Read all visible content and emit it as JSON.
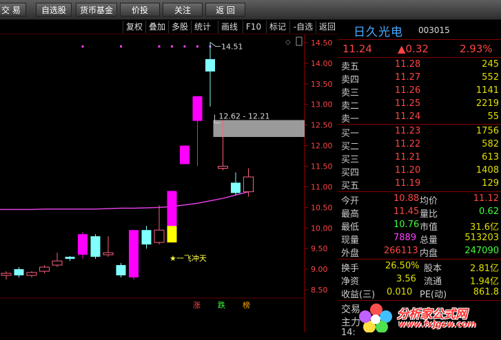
{
  "toolbar": {
    "items": [
      "交 易",
      "自选股",
      "货币基金",
      "价投",
      "关注",
      "返 回"
    ]
  },
  "subtoolbar": {
    "items": [
      "复权",
      "叠加",
      "多股",
      "统计",
      "画线",
      "F10",
      "标记",
      "-自选",
      "返回"
    ]
  },
  "stock": {
    "name": "日久光电",
    "code": "003015",
    "price": "11.24",
    "change": "▲0.32",
    "change_pct": "2.93%"
  },
  "order_book": {
    "asks": [
      {
        "label": "卖五",
        "price": "11.28",
        "qty": "245"
      },
      {
        "label": "卖四",
        "price": "11.27",
        "qty": "552"
      },
      {
        "label": "卖三",
        "price": "11.26",
        "qty": "1141"
      },
      {
        "label": "卖二",
        "price": "11.25",
        "qty": "2219"
      },
      {
        "label": "卖一",
        "price": "11.24",
        "qty": "55"
      }
    ],
    "bids": [
      {
        "label": "买一",
        "price": "11.23",
        "qty": "1756"
      },
      {
        "label": "买二",
        "price": "11.22",
        "qty": "582"
      },
      {
        "label": "买三",
        "price": "11.21",
        "qty": "613"
      },
      {
        "label": "买四",
        "price": "11.20",
        "qty": "1408"
      },
      {
        "label": "买五",
        "price": "11.19",
        "qty": "129"
      }
    ]
  },
  "quote": {
    "open_label": "今开",
    "open": "10.88",
    "avg_label": "均价",
    "avg": "11.12",
    "high_label": "最高",
    "high": "11.45",
    "ratio_label": "量比",
    "ratio": "0.62",
    "low_label": "最低",
    "low": "10.76",
    "mcap_label": "市值",
    "mcap": "31.6亿",
    "vol_label": "现量",
    "vol": "7889",
    "total_label": "总量",
    "total": "513203",
    "outer_label": "外盘",
    "outer": "266113",
    "inner_label": "内盘",
    "inner": "247090",
    "turnover_label": "换手",
    "turnover": "26.50%",
    "shares_label": "股本",
    "shares": "2.81亿",
    "nav_label": "净资",
    "nav": "3.56",
    "float_label": "流通",
    "float": "1.94亿",
    "eps_label": "收益(三)",
    "eps": "0.010",
    "pe_label": "PE(动)",
    "pe": "861.8"
  },
  "bottom": {
    "trade_label": "交易",
    "main_label": "主力",
    "time_label": "14:"
  },
  "watermark": {
    "line1": "分析家公式网",
    "line2": "www.fxjgsw.com"
  },
  "chart_data": {
    "type": "candlestick",
    "y_ticks": [
      "14.50",
      "14.00",
      "13.50",
      "13.00",
      "12.50",
      "12.00",
      "11.50",
      "11.00",
      "10.50",
      "10.00",
      "9.50",
      "9.00",
      "8.50"
    ],
    "ylim": [
      8.3,
      14.7
    ],
    "candles": [
      {
        "o": 8.85,
        "c": 8.9,
        "h": 8.95,
        "l": 8.75,
        "color": "pink"
      },
      {
        "o": 8.85,
        "c": 9.0,
        "h": 9.05,
        "l": 8.8,
        "color": "cyan"
      },
      {
        "o": 8.85,
        "c": 8.92,
        "h": 8.95,
        "l": 8.8,
        "color": "pink"
      },
      {
        "o": 8.95,
        "c": 9.05,
        "h": 9.1,
        "l": 8.9,
        "color": "pink"
      },
      {
        "o": 9.1,
        "c": 9.2,
        "h": 9.4,
        "l": 9.05,
        "color": "pink"
      },
      {
        "o": 9.25,
        "c": 9.3,
        "h": 9.32,
        "l": 9.2,
        "color": "cyan"
      },
      {
        "o": 9.35,
        "c": 9.85,
        "h": 9.9,
        "l": 9.25,
        "color": "magenta"
      },
      {
        "o": 9.3,
        "c": 9.8,
        "h": 9.85,
        "l": 9.25,
        "color": "cyan"
      },
      {
        "o": 9.35,
        "c": 9.4,
        "h": 9.8,
        "l": 9.3,
        "color": "pink"
      },
      {
        "o": 8.85,
        "c": 9.1,
        "h": 9.15,
        "l": 8.8,
        "color": "cyan"
      },
      {
        "o": 8.8,
        "c": 9.95,
        "h": 9.95,
        "l": 8.75,
        "color": "magenta"
      },
      {
        "o": 9.6,
        "c": 9.95,
        "h": 10.05,
        "l": 9.5,
        "color": "cyan"
      },
      {
        "o": 9.65,
        "c": 9.95,
        "h": 10.55,
        "l": 9.6,
        "color": "pink"
      },
      {
        "o": 9.65,
        "c": 10.9,
        "h": 10.9,
        "l": 9.65,
        "color": "magenta"
      },
      {
        "o": 11.55,
        "c": 12.0,
        "h": 12.0,
        "l": 11.55,
        "color": "magenta"
      },
      {
        "o": 12.6,
        "c": 13.2,
        "h": 13.2,
        "l": 11.5,
        "color": "magenta"
      },
      {
        "o": 13.8,
        "c": 14.1,
        "h": 14.51,
        "l": 12.95,
        "color": "cyan"
      },
      {
        "o": 11.5,
        "c": 11.45,
        "h": 12.62,
        "l": 11.4,
        "color": "pink"
      },
      {
        "o": 10.85,
        "c": 11.1,
        "h": 11.35,
        "l": 10.8,
        "color": "cyan"
      },
      {
        "o": 10.88,
        "c": 11.24,
        "h": 11.45,
        "l": 10.76,
        "color": "pink"
      }
    ],
    "ma": [
      10.45,
      10.45,
      10.45,
      10.46,
      10.46,
      10.46,
      10.46,
      10.46,
      10.47,
      10.48,
      10.48,
      10.49,
      10.5,
      10.52,
      10.56,
      10.6,
      10.66,
      10.72,
      10.8,
      10.88
    ],
    "annotations": {
      "high_label": "14.51",
      "range_label": "12.62 - 12.21",
      "signal_label": "★一飞冲天"
    },
    "gap": [
      12.21,
      12.62
    ],
    "bottom_labels": [
      "涨",
      "跌",
      "榜"
    ]
  }
}
